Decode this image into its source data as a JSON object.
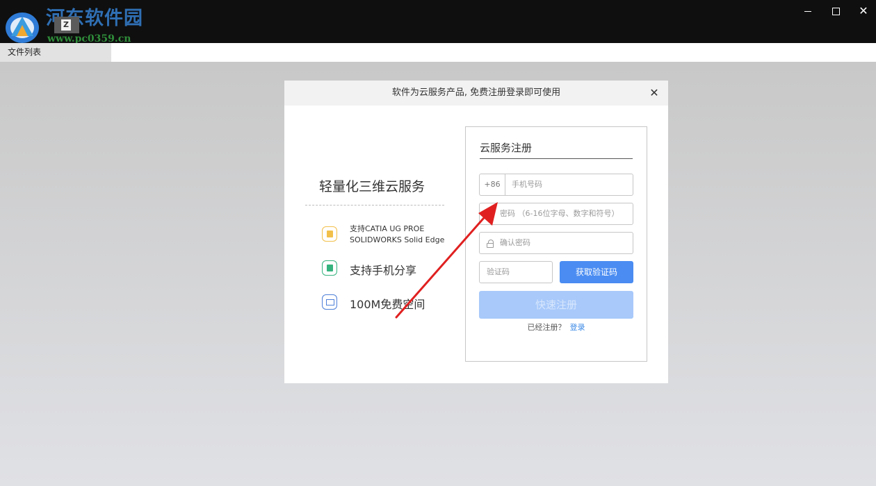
{
  "watermark": {
    "title": "河东软件园",
    "url": "www.pc0359.cn"
  },
  "app": {
    "icon_glyph": "Z"
  },
  "window_controls": {
    "minimize": "–",
    "maximize": "□",
    "close": "✕"
  },
  "tabs": [
    {
      "label": "文件列表"
    }
  ],
  "dialog": {
    "header": "软件为云服务产品, 免费注册登录即可使用",
    "close_glyph": "✕",
    "promo": {
      "title": "轻量化三维云服务",
      "features": [
        {
          "icon": "layers-icon",
          "text": "支持CATIA UG PROE SOLIDWORKS Solid Edge"
        },
        {
          "icon": "share-icon",
          "text": "支持手机分享"
        },
        {
          "icon": "monitor-icon",
          "text": "100M免费空间"
        }
      ]
    },
    "register": {
      "title": "云服务注册",
      "phone_prefix": "+86",
      "phone_placeholder": "手机号码",
      "password_placeholder": "密码 （6-16位字母、数字和符号）",
      "confirm_placeholder": "确认密码",
      "code_placeholder": "验证码",
      "get_code_label": "获取验证码",
      "submit_label": "快速注册",
      "already_registered": "已经注册？",
      "login_link": "登录"
    }
  },
  "colors": {
    "titlebar": "#0f0f0f",
    "accent_blue": "#4a8cf2",
    "disabled_blue": "#a8c9fa",
    "annotation_red": "#e02020"
  }
}
